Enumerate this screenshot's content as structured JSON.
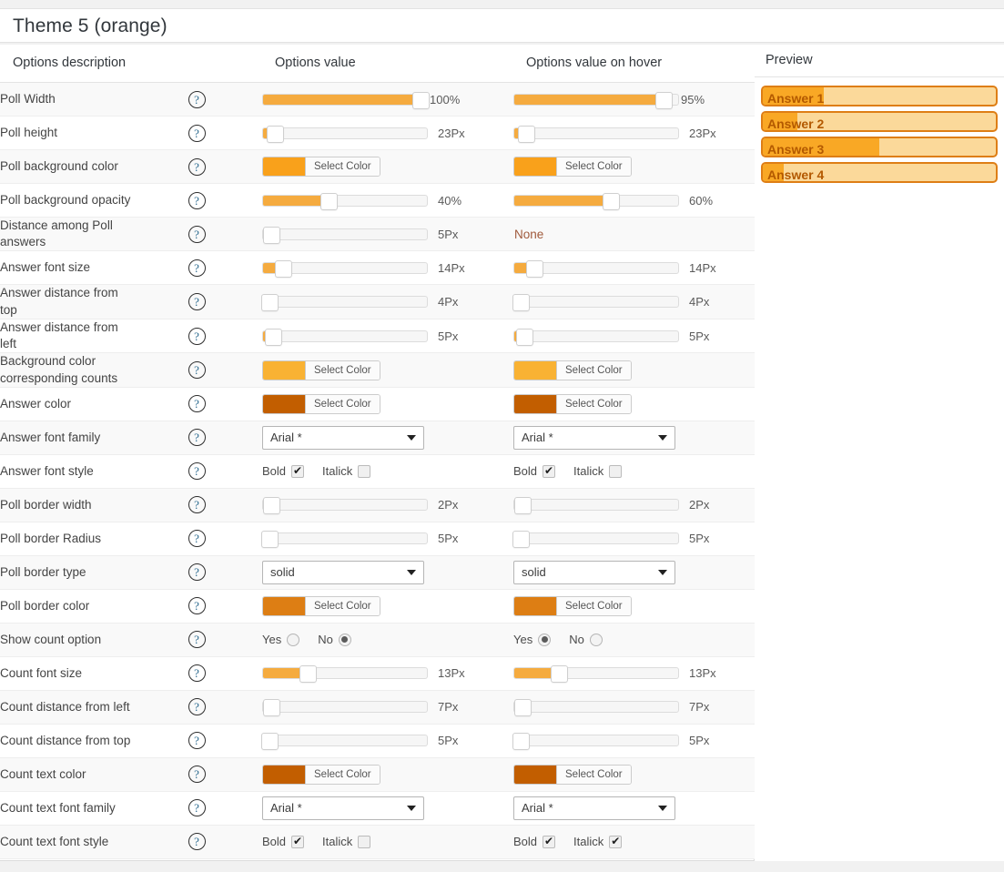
{
  "title": "Theme 5 (orange)",
  "colors": {
    "accent": "#f5ab3f",
    "poll_background": "#f9a11b",
    "counts_background": "#f9b233",
    "answer_color": "#c25e00",
    "poll_border_color": "#dd7e14",
    "count_text_color": "#c25e00",
    "preview_border": "#de7e15",
    "preview_track": "#fbd99a",
    "preview_fill": "#f9a825",
    "preview_text": "#b35900"
  },
  "headers": {
    "description": "Options description",
    "value": "Options value",
    "value_hover": "Options value on hover",
    "preview": "Preview"
  },
  "labels": {
    "select_color": "Select Color",
    "bold": "Bold",
    "italic": "Italick",
    "yes": "Yes",
    "no": "No",
    "none": "None",
    "help": "?"
  },
  "rows": [
    {
      "label": "Poll Width",
      "value": {
        "kind": "slider",
        "fill": 96,
        "knob": 96,
        "text": "100%"
      },
      "hover": {
        "kind": "slider",
        "fill": 91,
        "knob": 91,
        "text": "95%"
      }
    },
    {
      "label": "Poll height",
      "value": {
        "kind": "slider",
        "fill": 5,
        "knob": 7,
        "text": "23Px"
      },
      "hover": {
        "kind": "slider",
        "fill": 5,
        "knob": 7,
        "text": "23Px"
      }
    },
    {
      "label": "Poll background color",
      "value": {
        "kind": "color",
        "color": "#f9a11b",
        "text": "Select Color"
      },
      "hover": {
        "kind": "color",
        "color": "#f9a11b",
        "text": "Select Color"
      }
    },
    {
      "label": "Poll background opacity",
      "value": {
        "kind": "slider",
        "fill": 40,
        "knob": 40,
        "text": "40%"
      },
      "hover": {
        "kind": "slider",
        "fill": 59,
        "knob": 59,
        "text": "60%"
      }
    },
    {
      "label": "Distance among Poll answers",
      "value": {
        "kind": "slider",
        "fill": 3,
        "knob": 5,
        "text": "5Px"
      },
      "hover": {
        "kind": "none",
        "text": "None"
      }
    },
    {
      "label": "Answer font size",
      "value": {
        "kind": "slider",
        "fill": 10,
        "knob": 12,
        "text": "14Px"
      },
      "hover": {
        "kind": "slider",
        "fill": 10,
        "knob": 12,
        "text": "14Px"
      }
    },
    {
      "label": "Answer distance from top",
      "value": {
        "kind": "slider",
        "fill": 2,
        "knob": 4,
        "text": "4Px"
      },
      "hover": {
        "kind": "slider",
        "fill": 2,
        "knob": 4,
        "text": "4Px"
      }
    },
    {
      "label": "Answer distance from left",
      "value": {
        "kind": "slider",
        "fill": 4,
        "knob": 6,
        "text": "5Px"
      },
      "hover": {
        "kind": "slider",
        "fill": 4,
        "knob": 6,
        "text": "5Px"
      }
    },
    {
      "label": "Background color corresponding counts",
      "value": {
        "kind": "color",
        "color": "#f9b233",
        "text": "Select Color"
      },
      "hover": {
        "kind": "color",
        "color": "#f9b233",
        "text": "Select Color"
      }
    },
    {
      "label": "Answer color",
      "value": {
        "kind": "color",
        "color": "#c25e00",
        "text": "Select Color"
      },
      "hover": {
        "kind": "color",
        "color": "#c25e00",
        "text": "Select Color"
      }
    },
    {
      "label": "Answer font family",
      "value": {
        "kind": "select",
        "text": "Arial *"
      },
      "hover": {
        "kind": "select",
        "text": "Arial *"
      }
    },
    {
      "label": "Answer font style",
      "value": {
        "kind": "fontstyle",
        "bold": true,
        "italic": false
      },
      "hover": {
        "kind": "fontstyle",
        "bold": true,
        "italic": false
      }
    },
    {
      "label": "Poll border width",
      "value": {
        "kind": "slider",
        "fill": 3,
        "knob": 5,
        "text": "2Px"
      },
      "hover": {
        "kind": "slider",
        "fill": 3,
        "knob": 5,
        "text": "2Px"
      }
    },
    {
      "label": "Poll border Radius",
      "value": {
        "kind": "slider",
        "fill": 2,
        "knob": 4,
        "text": "5Px"
      },
      "hover": {
        "kind": "slider",
        "fill": 2,
        "knob": 4,
        "text": "5Px"
      }
    },
    {
      "label": "Poll border type",
      "value": {
        "kind": "select",
        "text": "solid"
      },
      "hover": {
        "kind": "select",
        "text": "solid"
      }
    },
    {
      "label": "Poll border color",
      "value": {
        "kind": "color",
        "color": "#dd7e14",
        "text": "Select Color"
      },
      "hover": {
        "kind": "color",
        "color": "#dd7e14",
        "text": "Select Color"
      }
    },
    {
      "label": "Show count option",
      "value": {
        "kind": "yesno",
        "selected": "No"
      },
      "hover": {
        "kind": "yesno",
        "selected": "Yes"
      }
    },
    {
      "label": "Count font size",
      "value": {
        "kind": "slider",
        "fill": 26,
        "knob": 27,
        "text": "13Px"
      },
      "hover": {
        "kind": "slider",
        "fill": 26,
        "knob": 27,
        "text": "13Px"
      }
    },
    {
      "label": "Count distance from left",
      "value": {
        "kind": "slider",
        "fill": 3,
        "knob": 5,
        "text": "7Px"
      },
      "hover": {
        "kind": "slider",
        "fill": 3,
        "knob": 5,
        "text": "7Px"
      }
    },
    {
      "label": "Count distance from top",
      "value": {
        "kind": "slider",
        "fill": 2,
        "knob": 4,
        "text": "5Px"
      },
      "hover": {
        "kind": "slider",
        "fill": 2,
        "knob": 4,
        "text": "5Px"
      }
    },
    {
      "label": "Count text color",
      "value": {
        "kind": "color",
        "color": "#c25e00",
        "text": "Select Color"
      },
      "hover": {
        "kind": "color",
        "color": "#c25e00",
        "text": "Select Color"
      }
    },
    {
      "label": "Count text font family",
      "value": {
        "kind": "select",
        "text": "Arial *"
      },
      "hover": {
        "kind": "select",
        "text": "Arial *"
      }
    },
    {
      "label": "Count text font style",
      "value": {
        "kind": "fontstyle",
        "bold": true,
        "italic": false
      },
      "hover": {
        "kind": "fontstyle",
        "bold": true,
        "italic": true
      }
    }
  ],
  "preview": {
    "answers": [
      {
        "label": "Answer 1",
        "fill": 26
      },
      {
        "label": "Answer 2",
        "fill": 15
      },
      {
        "label": "Answer 3",
        "fill": 50
      },
      {
        "label": "Answer 4",
        "fill": 9
      }
    ]
  }
}
